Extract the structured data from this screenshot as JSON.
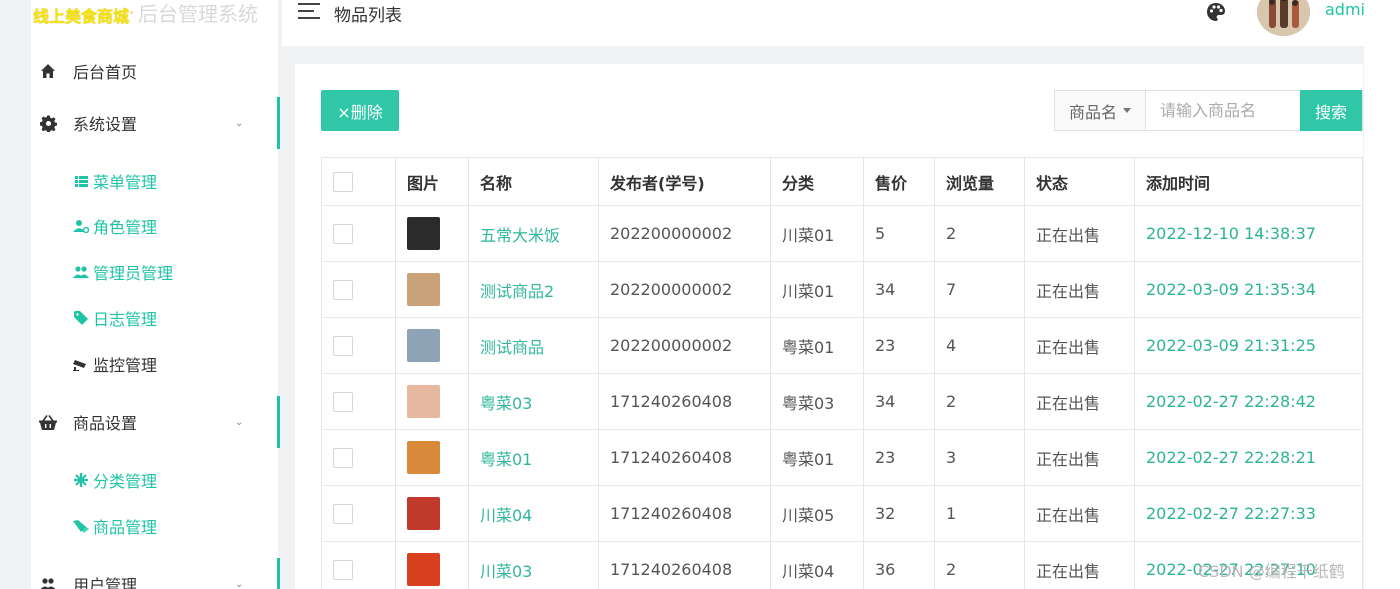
{
  "logo": {
    "main": "线上美食商城",
    "separator": "·",
    "sub": "后台管理系统"
  },
  "header": {
    "title": "物品列表",
    "username": "admi"
  },
  "sidebar": {
    "home": {
      "label": "后台首页",
      "icon": "home-icon"
    },
    "system": {
      "label": "系统设置",
      "icon": "gear-icon",
      "items": [
        {
          "label": "菜单管理",
          "icon": "list-icon"
        },
        {
          "label": "角色管理",
          "icon": "user-gear-icon"
        },
        {
          "label": "管理员管理",
          "icon": "users-icon"
        },
        {
          "label": "日志管理",
          "icon": "tag-icon"
        },
        {
          "label": "监控管理",
          "icon": "camera-icon"
        }
      ]
    },
    "goods": {
      "label": "商品设置",
      "icon": "basket-icon",
      "items": [
        {
          "label": "分类管理",
          "icon": "asterisk-icon"
        },
        {
          "label": "商品管理",
          "icon": "tags-icon"
        }
      ]
    },
    "users": {
      "label": "用户管理",
      "icon": "users-icon"
    }
  },
  "toolbar": {
    "delete_label": "×删除",
    "search_field": "商品名",
    "search_placeholder": "请输入商品名",
    "search_label": "搜索"
  },
  "table": {
    "headers": [
      "图片",
      "名称",
      "发布者(学号)",
      "分类",
      "售价",
      "浏览量",
      "状态",
      "添加时间"
    ],
    "rows": [
      {
        "name": "五常大米饭",
        "publisher": "202200000002",
        "category": "川菜01",
        "price": "5",
        "views": "2",
        "status": "正在出售",
        "time": "2022-12-10 14:38:37",
        "thumb_color": "#2b2b2b"
      },
      {
        "name": "测试商品2",
        "publisher": "202200000002",
        "category": "川菜01",
        "price": "34",
        "views": "7",
        "status": "正在出售",
        "time": "2022-03-09 21:35:34",
        "thumb_color": "#c9a27a"
      },
      {
        "name": "测试商品",
        "publisher": "202200000002",
        "category": "粤菜01",
        "price": "23",
        "views": "4",
        "status": "正在出售",
        "time": "2022-03-09 21:31:25",
        "thumb_color": "#8fa3b6"
      },
      {
        "name": "粤菜03",
        "publisher": "171240260408",
        "category": "粤菜03",
        "price": "34",
        "views": "2",
        "status": "正在出售",
        "time": "2022-02-27 22:28:42",
        "thumb_color": "#e6b8a0"
      },
      {
        "name": "粤菜01",
        "publisher": "171240260408",
        "category": "粤菜01",
        "price": "23",
        "views": "3",
        "status": "正在出售",
        "time": "2022-02-27 22:28:21",
        "thumb_color": "#d88a3a"
      },
      {
        "name": "川菜04",
        "publisher": "171240260408",
        "category": "川菜05",
        "price": "32",
        "views": "1",
        "status": "正在出售",
        "time": "2022-02-27 22:27:33",
        "thumb_color": "#c0392b"
      },
      {
        "name": "川菜03",
        "publisher": "171240260408",
        "category": "川菜04",
        "price": "36",
        "views": "2",
        "status": "正在出售",
        "time": "2022-02-27 22:27:10",
        "thumb_color": "#d9401f"
      }
    ]
  },
  "watermark": "CSDN @编程千纸鹤",
  "colors": {
    "accent": "#30c7a8",
    "link": "#32b79b"
  }
}
